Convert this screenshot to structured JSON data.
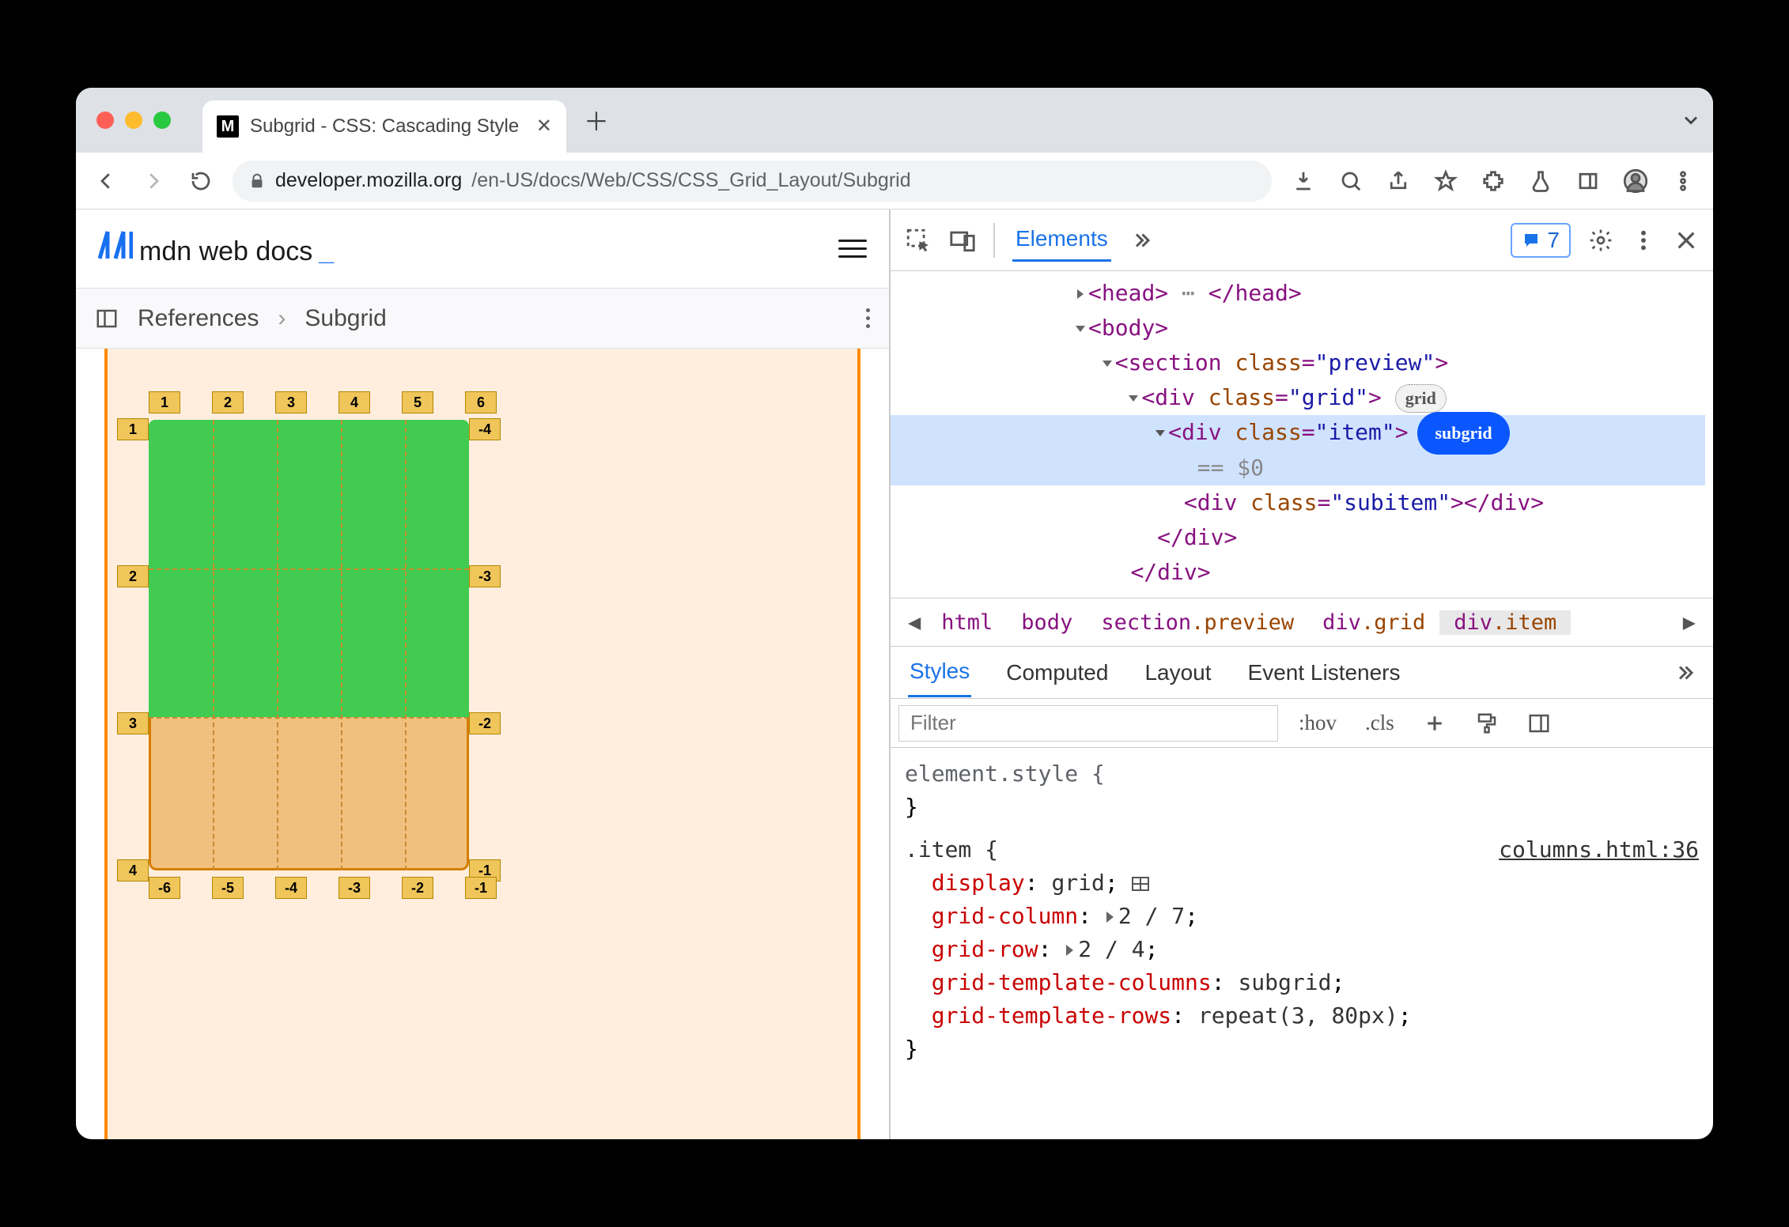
{
  "tab": {
    "title": "Subgrid - CSS: Cascading Style"
  },
  "url": {
    "domain": "developer.mozilla.org",
    "path": "/en-US/docs/Web/CSS/CSS_Grid_Layout/Subgrid"
  },
  "mdn": {
    "logo": "mdn web docs",
    "blink": "_"
  },
  "breadcrumb": {
    "root": "References",
    "leaf": "Subgrid"
  },
  "gridLabels": {
    "topCols": [
      "1",
      "2",
      "3",
      "4",
      "5",
      "6"
    ],
    "leftRows": [
      "1",
      "2",
      "3",
      "4"
    ],
    "rightRows": [
      "-4",
      "-3",
      "-2",
      "-1"
    ],
    "bottomCols": [
      "-6",
      "-5",
      "-4",
      "-3",
      "-2",
      "-1"
    ]
  },
  "devtools": {
    "mainTab": "Elements",
    "issues": "7",
    "dom": {
      "head_open": "<head>",
      "head_close": "</head>",
      "body_open": "<body>",
      "section_open": "<section class=\"preview\">",
      "div_grid_open": "<div class=\"grid\">",
      "div_item_open": "<div class=\"item\">",
      "badge_grid": "grid",
      "badge_subgrid": "subgrid",
      "eq0": " == $0",
      "subitem": "<div class=\"subitem\"></div>",
      "close_div": "</div>"
    },
    "crumbs": [
      "html",
      "body",
      "section.preview",
      "div.grid",
      "div.item"
    ],
    "styleTabs": [
      "Styles",
      "Computed",
      "Layout",
      "Event Listeners"
    ],
    "filterPlaceholder": "Filter",
    "hov": ":hov",
    "cls": ".cls",
    "elementStyle": "element.style {",
    "closeBrace": "}",
    "ruleSel": ".item {",
    "ruleSrc": "columns.html:36",
    "decls": {
      "display": "display",
      "display_v": "grid",
      "gc": "grid-column",
      "gc_v": "2 / 7",
      "gr": "grid-row",
      "gr_v": "2 / 4",
      "gtc": "grid-template-columns",
      "gtc_v": "subgrid",
      "gtr": "grid-template-rows",
      "gtr_v": "repeat(3, 80px)"
    }
  }
}
